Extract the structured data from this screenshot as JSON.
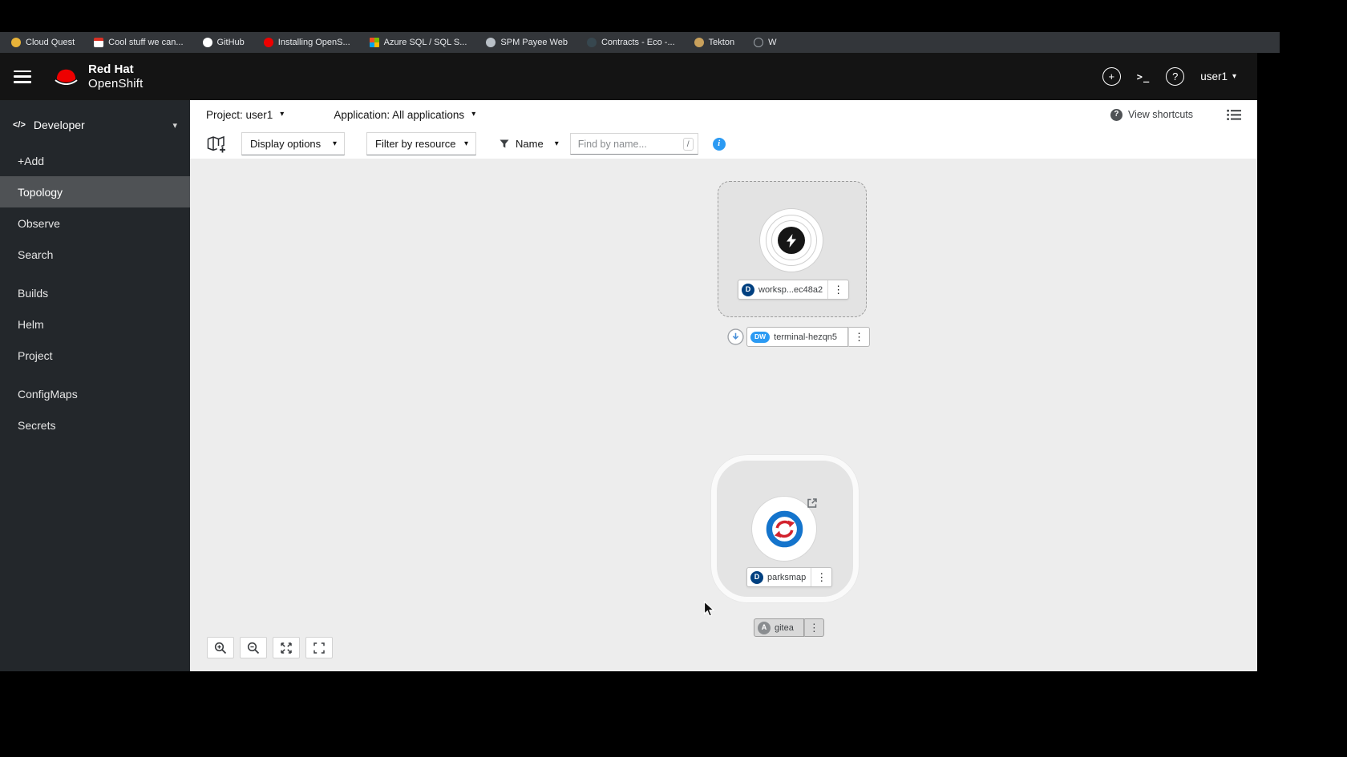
{
  "browser": {
    "bookmarks": [
      {
        "label": "Cloud Quest"
      },
      {
        "label": "Cool stuff we can..."
      },
      {
        "label": "GitHub"
      },
      {
        "label": "Installing OpenS..."
      },
      {
        "label": "Azure SQL / SQL S..."
      },
      {
        "label": "SPM Payee Web"
      },
      {
        "label": "Contracts - Eco -..."
      },
      {
        "label": "Tekton"
      },
      {
        "label": "W"
      }
    ]
  },
  "masthead": {
    "brand_line1": "Red Hat",
    "brand_line2": "OpenShift",
    "user_menu": "user1"
  },
  "sidebar": {
    "perspective": "Developer",
    "active_item": "Topology",
    "groups": [
      {
        "items": [
          "+Add",
          "Topology",
          "Observe",
          "Search"
        ]
      },
      {
        "items": [
          "Builds",
          "Helm",
          "Project"
        ]
      },
      {
        "items": [
          "ConfigMaps",
          "Secrets"
        ]
      }
    ]
  },
  "context_bar": {
    "project": "Project: user1",
    "application": "Application: All applications",
    "view_shortcuts": "View shortcuts"
  },
  "toolbar": {
    "display_options": "Display options",
    "filter_by_resource": "Filter by resource",
    "name_filter": "Name",
    "find_placeholder": "Find by name...",
    "shortcut_hint": "/"
  },
  "topology": {
    "workspace": {
      "badge": "D",
      "label": "worksp...ec48a2"
    },
    "terminal": {
      "badge": "DW",
      "label": "terminal-hezqn5"
    },
    "parksmap": {
      "badge": "D",
      "label": "parksmap"
    },
    "gitea": {
      "badge": "A",
      "label": "gitea"
    }
  },
  "glyphs": {
    "caret_down": "▾",
    "kebab": "⋮",
    "plus": "+",
    "terminal_prompt": ">_",
    "question_mark": "?",
    "code": "</>",
    "info": "i"
  },
  "colors": {
    "brand_red": "#ee0000",
    "accent_blue": "#2b9af3",
    "badge_deployment": "#004080",
    "badge_devworkspace": "#2b9af3",
    "badge_application": "#8a8d90",
    "sidebar_active_bg": "#4f5255",
    "canvas_bg": "#ededed"
  }
}
